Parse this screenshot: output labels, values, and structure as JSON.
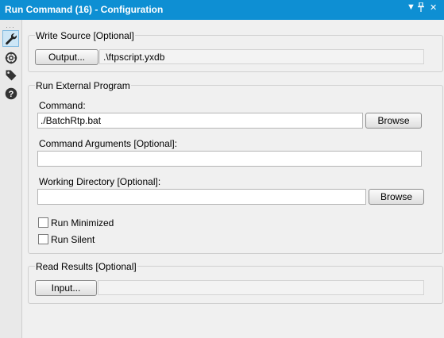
{
  "window": {
    "title": "Run Command (16) - Configuration",
    "dropdown_glyph": "▼",
    "pin_glyph": "📌",
    "close_glyph": "✕"
  },
  "colors": {
    "titlebar": "#0e8fd3"
  },
  "sidebar": {
    "icons": [
      "wrench-icon",
      "target-icon",
      "tag-icon",
      "help-icon"
    ],
    "active": "wrench-icon"
  },
  "write_source": {
    "title": "Write Source [Optional]",
    "button_label": "Output...",
    "value": ".\\ftpscript.yxdb"
  },
  "run_external": {
    "title": "Run External Program",
    "command_label": "Command:",
    "command_value": "./BatchRtp.bat",
    "browse_label": "Browse",
    "args_label": "Command Arguments [Optional]:",
    "args_value": "",
    "workdir_label": "Working Directory [Optional]:",
    "workdir_value": "",
    "workdir_browse_label": "Browse",
    "run_minimized_label": "Run Minimized",
    "run_minimized_checked": false,
    "run_silent_label": "Run Silent",
    "run_silent_checked": false
  },
  "read_results": {
    "title": "Read Results [Optional]",
    "button_label": "Input...",
    "value": ""
  }
}
